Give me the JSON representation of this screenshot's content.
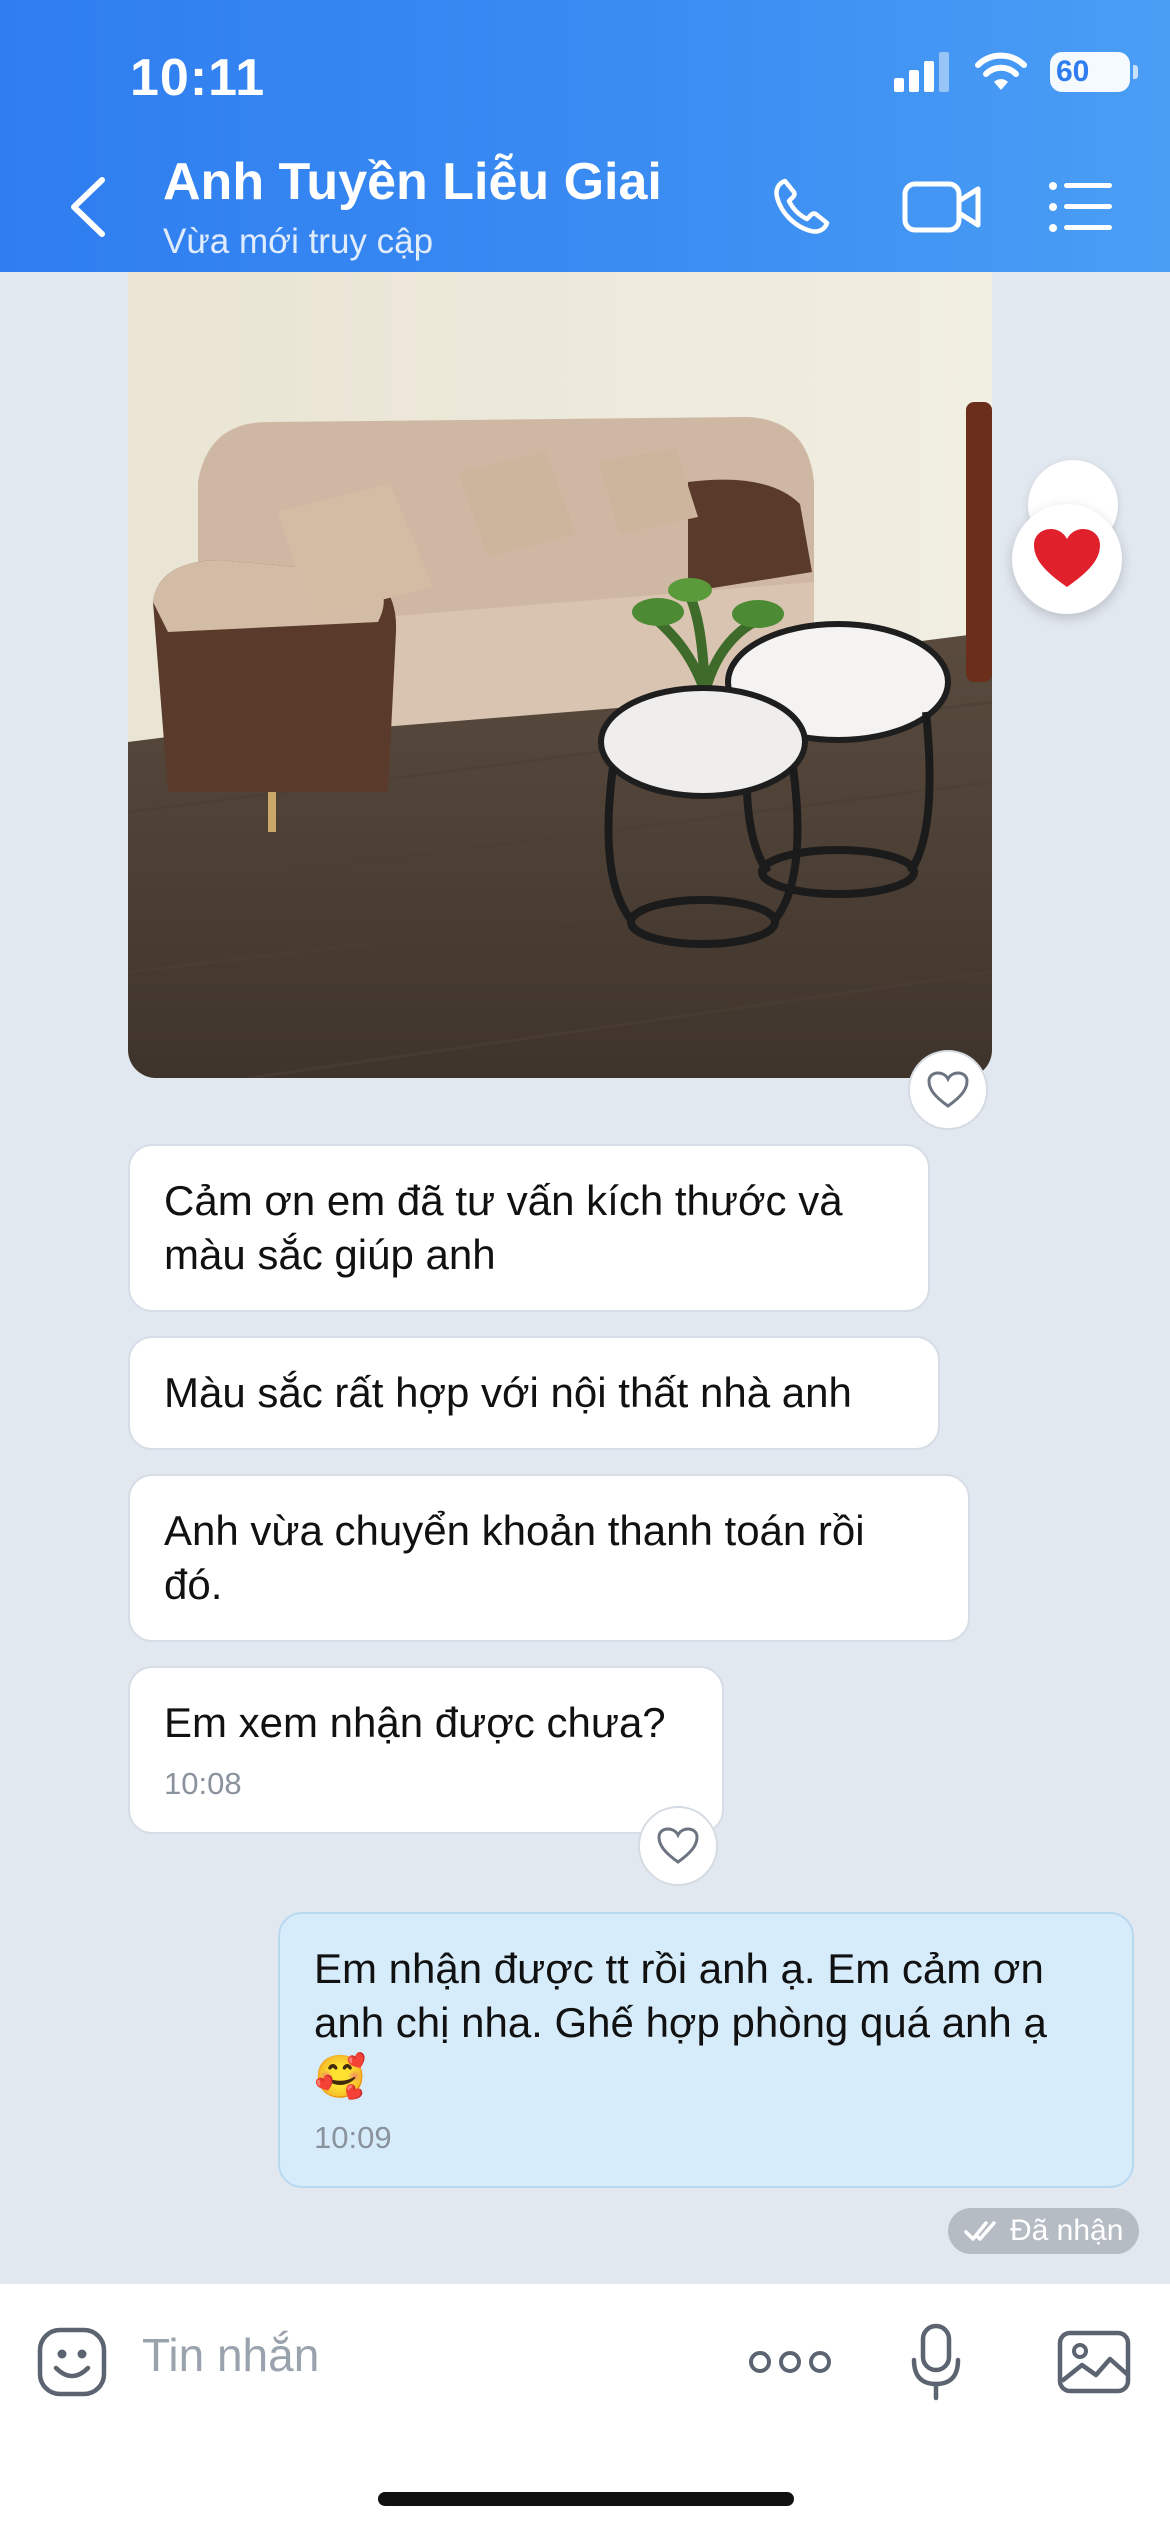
{
  "status_bar": {
    "time": "10:11",
    "battery": "60"
  },
  "header": {
    "contact_name": "Anh Tuyền Liễu Giai",
    "contact_status": "Vừa mới truy cập"
  },
  "messages": [
    {
      "direction": "in",
      "text": "Cảm ơn em đã tư vấn kích thước và màu sắc giúp anh"
    },
    {
      "direction": "in",
      "text": "Màu sắc rất hợp với nội thất nhà anh"
    },
    {
      "direction": "in",
      "text": "Anh vừa chuyển khoản thanh toán rồi đó."
    },
    {
      "direction": "in",
      "text": "Em xem nhận được chưa?",
      "time": "10:08"
    },
    {
      "direction": "out",
      "text": "Em nhận được tt rồi anh ạ. Em cảm ơn anh chị nha. Ghế hợp phòng quá anh ạ",
      "emoji": "🥰",
      "time": "10:09"
    }
  ],
  "received_status": "Đã nhận",
  "input": {
    "placeholder": "Tin nhắn"
  },
  "colors": {
    "header_blue": "#3a8cf2",
    "outgoing_bubble": "#d6ecfb",
    "reaction_red": "#e0202b"
  }
}
